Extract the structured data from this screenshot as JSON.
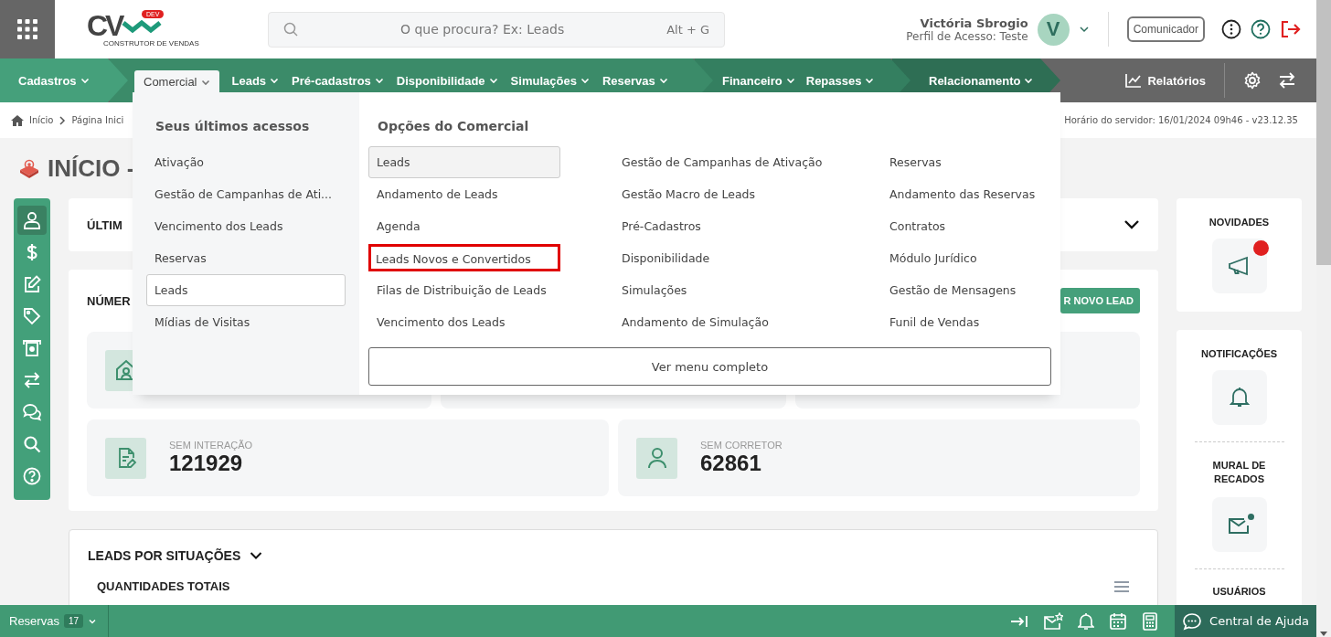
{
  "header": {
    "logo": {
      "mark": "CV",
      "badge": "DEV",
      "tagline": "CONSTRUTOR DE VENDAS"
    },
    "search": {
      "placeholder": "O que procura? Ex: Leads",
      "shortcut": "Alt + G"
    },
    "user": {
      "name": "Victória Sbrogio",
      "profile": "Perfil de Acesso: Teste",
      "avatar": "V"
    },
    "communicator_button": "Comunicador"
  },
  "nav": [
    {
      "items": [
        {
          "label": "Cadastros",
          "selected": false
        }
      ]
    },
    {
      "items": [
        {
          "label": "Comercial",
          "selected": true
        },
        {
          "label": "Leads",
          "selected": false
        },
        {
          "label": "Pré-cadastros",
          "selected": false
        },
        {
          "label": "Disponibilidade",
          "selected": false
        },
        {
          "label": "Simulações",
          "selected": false
        },
        {
          "label": "Reservas",
          "selected": false
        }
      ]
    },
    {
      "items": [
        {
          "label": "Financeiro",
          "selected": false
        },
        {
          "label": "Repasses",
          "selected": false
        }
      ]
    },
    {
      "items": [
        {
          "label": "Relacionamento",
          "selected": false
        }
      ]
    }
  ],
  "reports_link": "Relatórios",
  "breadcrumb": [
    "Início",
    "Página Inici"
  ],
  "server_time": "Horário do servidor: 16/01/2024 09h46 - v23.12.35",
  "page_title": "INÍCIO -",
  "rail": [
    {
      "selected": true
    },
    {
      "selected": false
    },
    {
      "selected": false
    },
    {
      "selected": false
    },
    {
      "selected": false
    },
    {
      "selected": false
    },
    {
      "selected": false
    },
    {
      "selected": false
    },
    {
      "selected": false
    }
  ],
  "last_access_card": {
    "title": "ÚLTIM"
  },
  "numbers_card": {
    "title": "NÚMER",
    "new_lead_button": "R NOVO LEAD",
    "stats": [
      {
        "label": "SEM INTERAÇÃO",
        "value": "121929"
      },
      {
        "label": "SEM CORRETOR",
        "value": "62861"
      }
    ]
  },
  "leads_section": {
    "title": "LEADS POR SITUAÇÕES",
    "subtitle": "QUANTIDADES TOTAIS"
  },
  "side": {
    "news": {
      "title": "NOVIDADES",
      "unread": true
    },
    "notifications": "NOTIFICAÇÕES",
    "board": {
      "title": "MURAL DE RECADOS",
      "unread": true
    },
    "users": "USUÁRIOS"
  },
  "menu": {
    "recent_title": "Seus últimos acessos",
    "recent": [
      {
        "label": "Ativação",
        "selected": false
      },
      {
        "label": "Gestão de Campanhas de Ati...",
        "selected": false
      },
      {
        "label": "Vencimento dos Leads",
        "selected": false
      },
      {
        "label": "Reservas",
        "selected": false
      },
      {
        "label": "Leads",
        "selected": true
      },
      {
        "label": "Mídias de Visitas",
        "selected": false
      }
    ],
    "options_title": "Opções do Comercial",
    "columns": [
      [
        {
          "label": "Leads",
          "selected": true,
          "marked": false
        },
        {
          "label": "Andamento de Leads",
          "selected": false,
          "marked": false
        },
        {
          "label": "Agenda",
          "selected": false,
          "marked": false
        },
        {
          "label": "Leads Novos e Convertidos",
          "selected": false,
          "marked": true
        },
        {
          "label": "Filas de Distribuição de Leads",
          "selected": false,
          "marked": false
        },
        {
          "label": "Vencimento dos Leads",
          "selected": false,
          "marked": false
        }
      ],
      [
        {
          "label": "Gestão de Campanhas de Ativação",
          "selected": false,
          "marked": false
        },
        {
          "label": "Gestão Macro de Leads",
          "selected": false,
          "marked": false
        },
        {
          "label": "Pré-Cadastros",
          "selected": false,
          "marked": false
        },
        {
          "label": "Disponibilidade",
          "selected": false,
          "marked": false
        },
        {
          "label": "Simulações",
          "selected": false,
          "marked": false
        },
        {
          "label": "Andamento de Simulação",
          "selected": false,
          "marked": false
        }
      ],
      [
        {
          "label": "Reservas",
          "selected": false,
          "marked": false
        },
        {
          "label": "Andamento das Reservas",
          "selected": false,
          "marked": false
        },
        {
          "label": "Contratos",
          "selected": false,
          "marked": false
        },
        {
          "label": "Módulo Jurídico",
          "selected": false,
          "marked": false
        },
        {
          "label": "Gestão de Mensagens",
          "selected": false,
          "marked": false
        },
        {
          "label": "Funil de Vendas",
          "selected": false,
          "marked": false
        }
      ]
    ],
    "full_menu_button": "Ver menu completo"
  },
  "footer": {
    "reservas": {
      "label": "Reservas",
      "count": "17"
    },
    "help": "Central de Ajuda"
  }
}
